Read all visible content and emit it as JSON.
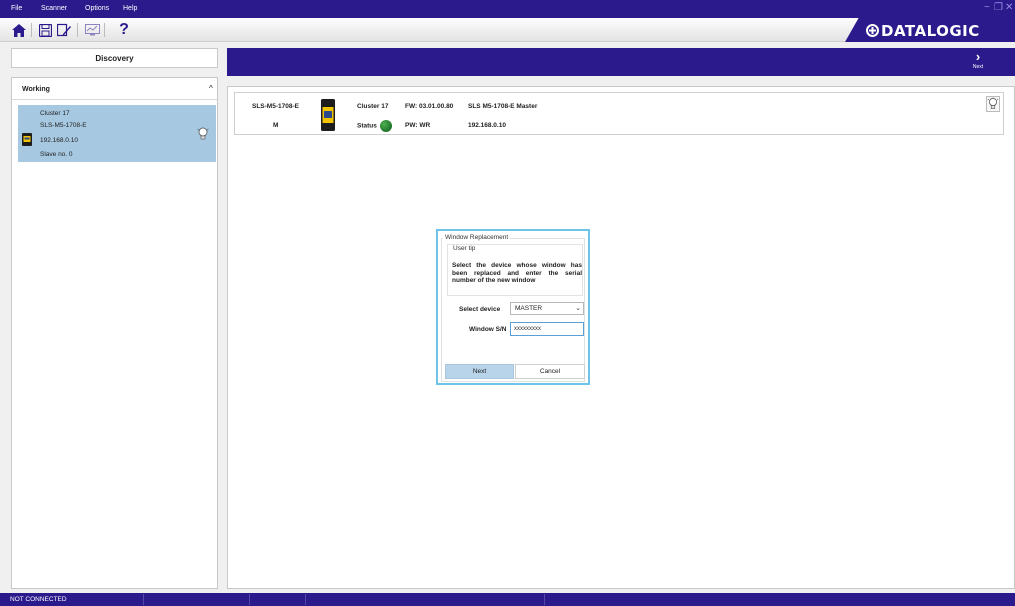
{
  "menu": {
    "items": [
      {
        "label": "File"
      },
      {
        "label": "Scanner"
      },
      {
        "label": "Options"
      },
      {
        "label": "Help"
      }
    ]
  },
  "window_controls": {
    "minimize": "−",
    "restore": "❐",
    "close": "✕"
  },
  "toolbar": {
    "help_glyph": "?"
  },
  "brand": {
    "logo_text": "DATALOGIC"
  },
  "discovery": {
    "label": "Discovery"
  },
  "nav": {
    "next_chevron": "›",
    "next_label": "Next"
  },
  "left_panel": {
    "header": "Working",
    "collapse_glyph": "^",
    "device": {
      "cluster": "Cluster 17",
      "model": "SLS-M5-1708-E",
      "ip": "192.168.0.10",
      "slave": "Slave no.   0"
    }
  },
  "device_row": {
    "model": "SLS-M5-1708-E",
    "role": "M",
    "cluster": "Cluster 17",
    "status_label": "Status",
    "fw": "FW: 03.01.00.80",
    "pw": "PW: WR",
    "name": "SLS M5-1708-E Master",
    "ip": "192.168.0.10"
  },
  "dialog": {
    "title": "Window Replacement",
    "tip_legend": "User tip",
    "tip_text": "Select the device whose window has been replaced and enter the serial number of the new window",
    "select_label": "Select device",
    "select_value": "MASTER",
    "sn_label": "Window S/N",
    "sn_value": "xxxxxxxxx",
    "next_button": "Next",
    "cancel_button": "Cancel"
  },
  "status_bar": {
    "connection": "NOT CONNECTED"
  },
  "colors": {
    "brand_purple": "#2a1a8c",
    "selection_blue": "#a6c8e0",
    "dialog_border": "#6ec3e8",
    "status_ok": "#1f8a2c"
  },
  "icons": [
    "home-icon",
    "save-icon",
    "edit-config-icon",
    "monitor-icon",
    "help-icon",
    "lightbulb-icon",
    "scanner-device-icon"
  ]
}
